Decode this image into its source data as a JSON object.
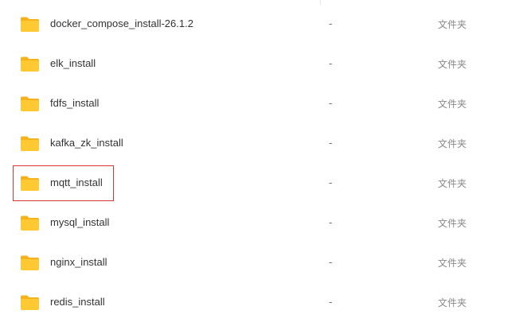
{
  "files": [
    {
      "name": "docker_compose_install-26.1.2",
      "size": "-",
      "type": "文件夹",
      "icon": "folder-icon"
    },
    {
      "name": "elk_install",
      "size": "-",
      "type": "文件夹",
      "icon": "folder-icon"
    },
    {
      "name": "fdfs_install",
      "size": "-",
      "type": "文件夹",
      "icon": "folder-icon"
    },
    {
      "name": "kafka_zk_install",
      "size": "-",
      "type": "文件夹",
      "icon": "folder-icon"
    },
    {
      "name": "mqtt_install",
      "size": "-",
      "type": "文件夹",
      "icon": "folder-icon"
    },
    {
      "name": "mysql_install",
      "size": "-",
      "type": "文件夹",
      "icon": "folder-icon"
    },
    {
      "name": "nginx_install",
      "size": "-",
      "type": "文件夹",
      "icon": "folder-icon"
    },
    {
      "name": "redis_install",
      "size": "-",
      "type": "文件夹",
      "icon": "folder-icon"
    }
  ],
  "selected_index": 4,
  "colors": {
    "folder_front": "#ffc933",
    "folder_back": "#f5b21b",
    "highlight_border": "#d93333"
  }
}
